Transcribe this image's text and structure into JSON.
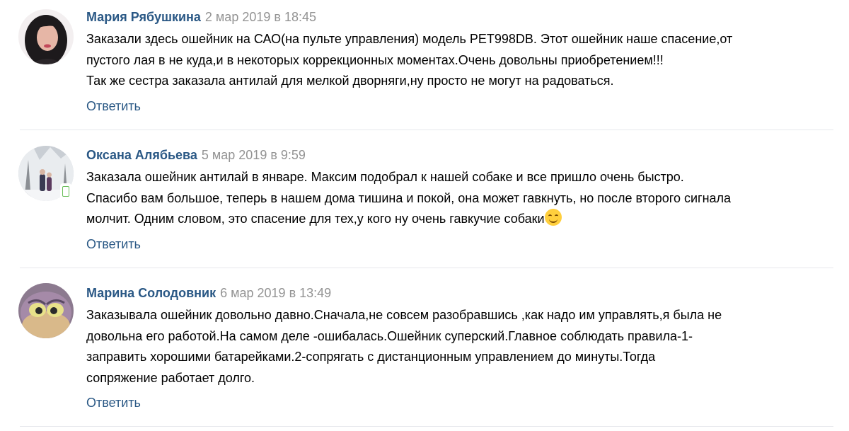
{
  "comments": [
    {
      "author": "Мария Рябушкина",
      "date": "2 мар 2019 в 18:45",
      "lines": [
        "Заказали здесь ошейник на САО(на пульте управления) модель РЕТ998DB. Этот ошейник наше спасение,от",
        "пустого лая в не куда,и в некоторых коррекционных моментах.Очень довольны приобретением!!!",
        "Так же сестра заказала антилай для мелкой дворняги,ну просто не могут на радоваться."
      ],
      "reply_label": "Ответить",
      "avatar_icon": "user-photo"
    },
    {
      "author": "Оксана Алябьева",
      "date": "5 мар 2019 в 9:59",
      "lines": [
        "Заказала ошейник антилай в январе. Максим подобрал к нашей собаке и все пришло очень быстро.",
        "Спасибо вам большое, теперь в нашем дома тишина и покой, она может гавкнуть, но после второго сигнала",
        "молчит. Одним словом, это спасение для тех,у кого ну очень гавкучие собаки"
      ],
      "emoji": "smiling-face",
      "reply_label": "Ответить",
      "avatar_icon": "user-photo",
      "mobile_indicator": "mobile-phone-icon"
    },
    {
      "author": "Марина Солодовник",
      "date": "6 мар 2019 в 13:49",
      "lines": [
        "Заказывала ошейник довольно давно.Сначала,не совсем разобравшись ,как надо им управлять,я была не",
        "довольна его работой.На самом деле -ошибалась.Ошейник суперский.Главное соблюдать правила-1-",
        "заправить хорошими батарейками.2-сопрягать с дистанционным управлением до минуты.Тогда",
        "сопряжение работает долго."
      ],
      "reply_label": "Ответить",
      "avatar_icon": "user-photo"
    }
  ],
  "colors": {
    "author": "#2a5885",
    "date": "#939393",
    "link": "#2a5885",
    "divider": "#e7e8ec",
    "emoji": "#ffcf3d",
    "mobile_indicator": "#6bbf5b"
  }
}
